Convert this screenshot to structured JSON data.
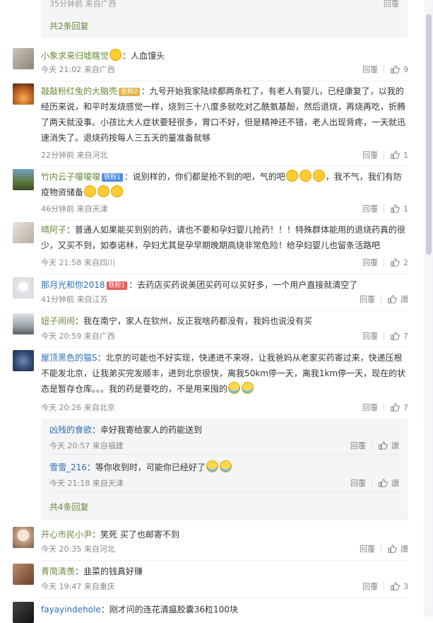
{
  "top_block": {
    "cut_meta": "35分钟前 来自广西",
    "cut_reply": "回覆",
    "more_replies": "共2条回复"
  },
  "comments": [
    {
      "user": "小象求来归墟瞎觉",
      "text": "：人血馒头",
      "time": "今天 21:02 来自广西",
      "reply": "回覆",
      "likes": "9"
    },
    {
      "user": "敲敲粉红兔的大脑壳",
      "badge": "金粉2",
      "text": "：九号开始我家陆续都两条杠了，有老人有婴儿，已经康复了，以我的经历来说，和平时发烧感觉一样，烧到三十八度多就吃对乙酰氨基酚，然后退烧，再烧再吃，折腾了两天就没事。小孩比大人症状要轻很多，胃口不好，但是精神还不错，老人出现背疼，一天就迅速消失了。退烧药按每人三五天的量准备就够",
      "time": "22分钟前 来自河北",
      "reply": "回覆",
      "likes": "1"
    },
    {
      "user": "竹内云子嗄嗄嗄",
      "badge": "铁粉1",
      "text": "：说别样的，你们都是抢不到的吧，气的吧",
      "text2": "，我不气，我们有防疫物资储备",
      "time": "46分钟前 来自天津",
      "reply": "回覆",
      "likes": "1"
    },
    {
      "user": "晴阿子",
      "text": "：普通人如果能买到别的药，请也不要和孕妇婴儿抢药！！！特殊群体能用的退烧药真的很少，又买不到，如泰诺林，孕妇尤其是孕早期晚期高烧非常危险！给孕妇婴儿也留条活路吧",
      "time": "今天 21:58 来自四川",
      "reply": "回覆",
      "likes": "2"
    },
    {
      "user": "那月光和你2018",
      "badge": "铁粉1",
      "text": "：去药店买药说美团买药可以买好多，一个用户直接就清空了",
      "time": "41分钟前 来自江苏",
      "reply": "回覆",
      "likes": "讚"
    },
    {
      "user": "妞子闹闹",
      "text": "：我在南宁，家人在钦州，反正我啥药都没有，我妈也说没有买",
      "time": "今天 20:59 来自广西",
      "reply": "回覆",
      "likes": "7"
    },
    {
      "user": "屋顶黑色的猫S",
      "text": "：北京的可能也不好实现，快递进不来呀，让我爸妈从老家买药寄过来，快递压根不能发北京，让我弟买完发顺丰，进到北京很快，离我50km停一天，离我1km停一天，现在的状态是暂存仓库。。。我的药是要吃的，不是用来囤的",
      "time": "今天 20:26 来自北京",
      "reply": "回覆",
      "likes": "7"
    }
  ],
  "replies": [
    {
      "user": "凶残的食欲",
      "text": "：幸好我寄给家人的药能送到",
      "time": "今天 20:57 来自福建",
      "reply": "回覆",
      "likes": "讚"
    },
    {
      "user": "雪雪_216",
      "text": "：等你收到时，可能你已经好了",
      "time": "今天 21:18 来自天津",
      "reply": "回覆",
      "likes": "讚"
    }
  ],
  "replies_more": "共4条回复",
  "comments2": [
    {
      "user": "开心市民小尹",
      "text": "：笑死 买了也邮寄不到",
      "time": "今天 20:35 来自河北",
      "reply": "回覆",
      "likes": "讚"
    },
    {
      "user": "青简清羡",
      "text": "：韭菜的钱真好赚",
      "time": "今天 19:47 来自重庆",
      "reply": "回覆",
      "likes": "3"
    },
    {
      "user": "fayayindehole",
      "text": "：刚才问的连花清瘟胶囊36粒100块"
    }
  ],
  "colors": {
    "accent_link": "#2d6fb5",
    "reply_more": "#6a8a3a",
    "reply_bg": "#f4f5f7"
  }
}
